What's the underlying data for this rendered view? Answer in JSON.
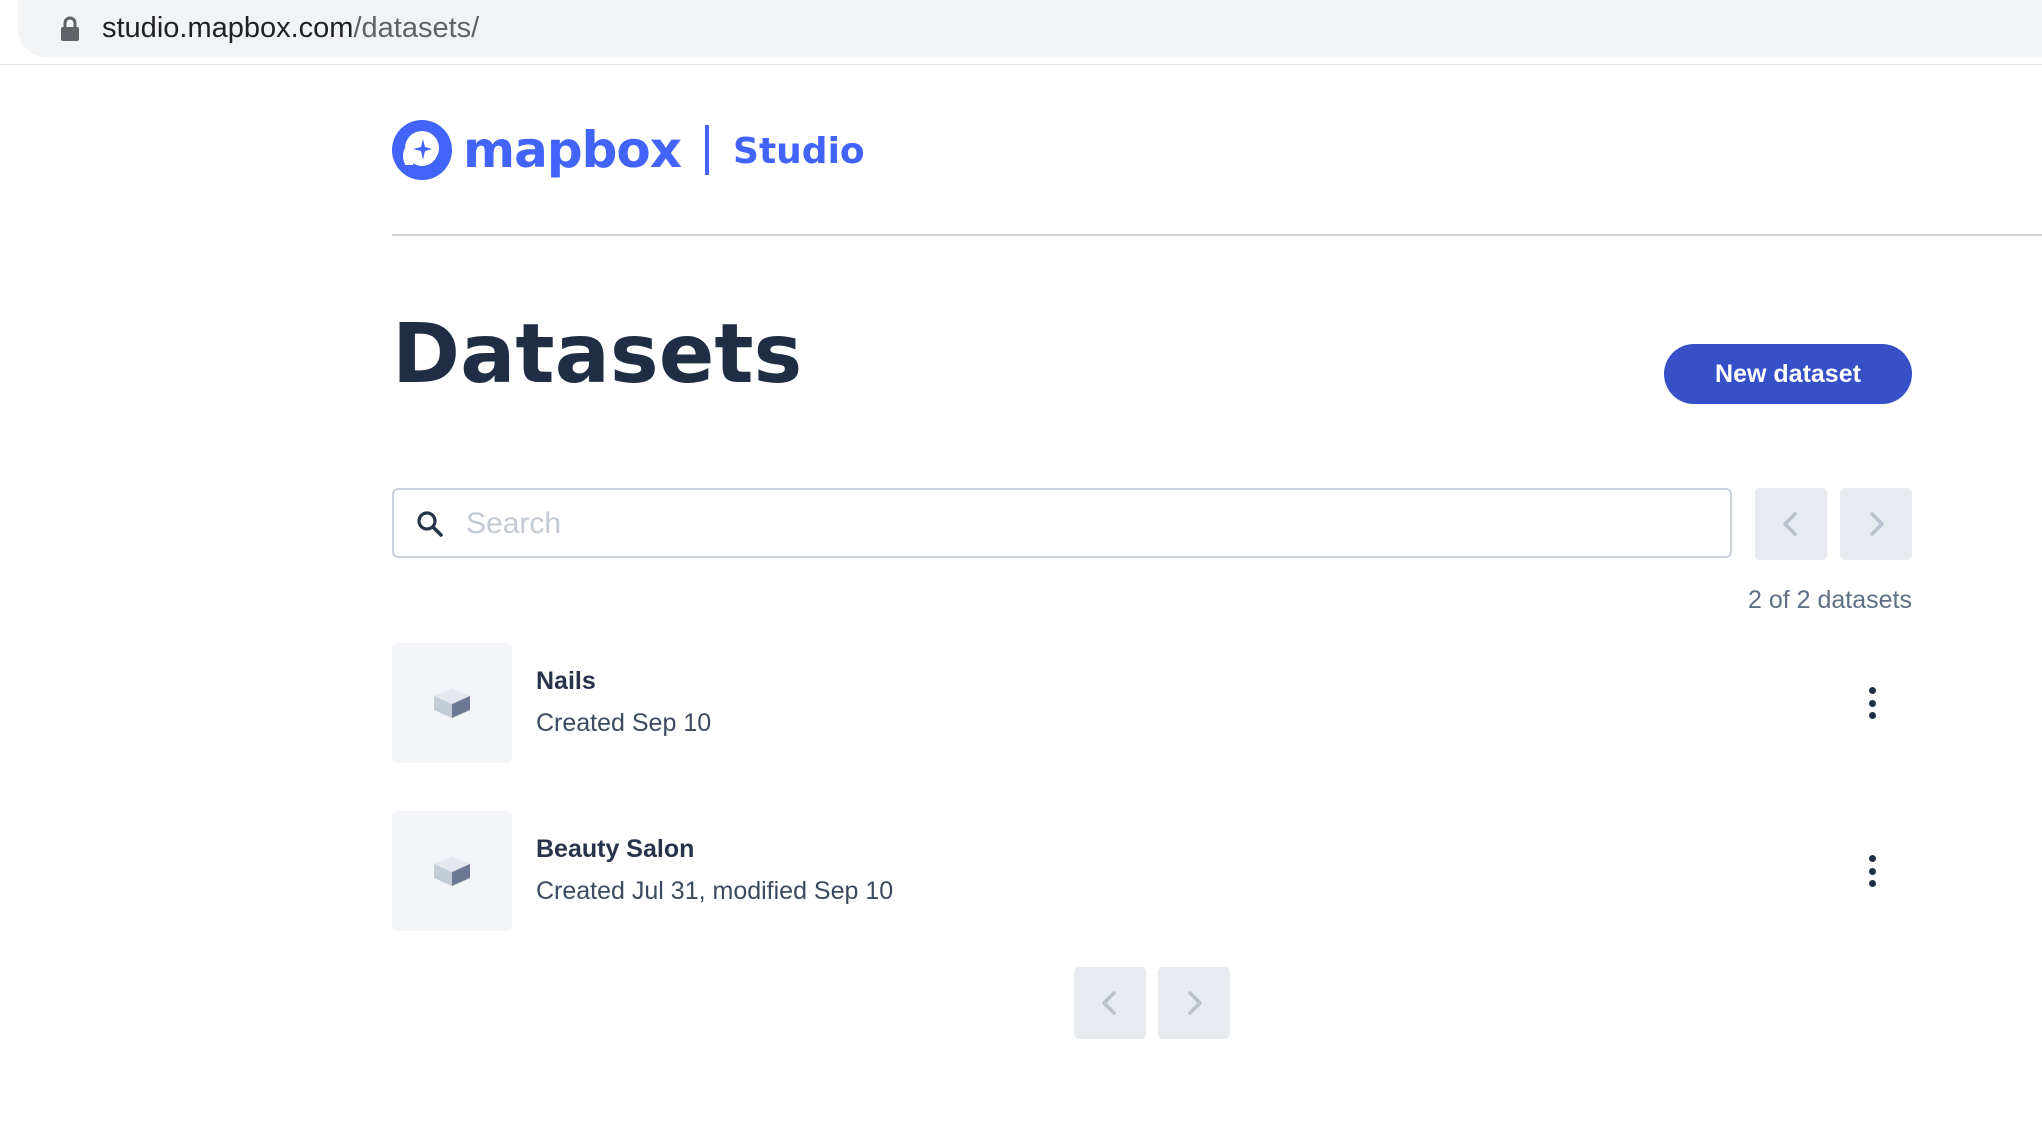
{
  "browser": {
    "url_host": "studio.mapbox.com",
    "url_path": "/datasets/"
  },
  "header": {
    "brand": "mapbox",
    "product": "Studio"
  },
  "page": {
    "title": "Datasets",
    "new_button_label": "New dataset"
  },
  "search": {
    "placeholder": "Search",
    "value": ""
  },
  "pagination": {
    "count_text": "2 of 2 datasets"
  },
  "datasets": [
    {
      "name": "Nails",
      "meta": "Created Sep 10"
    },
    {
      "name": "Beauty Salon",
      "meta": "Created Jul 31, modified Sep 10"
    }
  ],
  "colors": {
    "brand": "#4264fb",
    "button": "#3650c8",
    "text": "#27334a"
  }
}
